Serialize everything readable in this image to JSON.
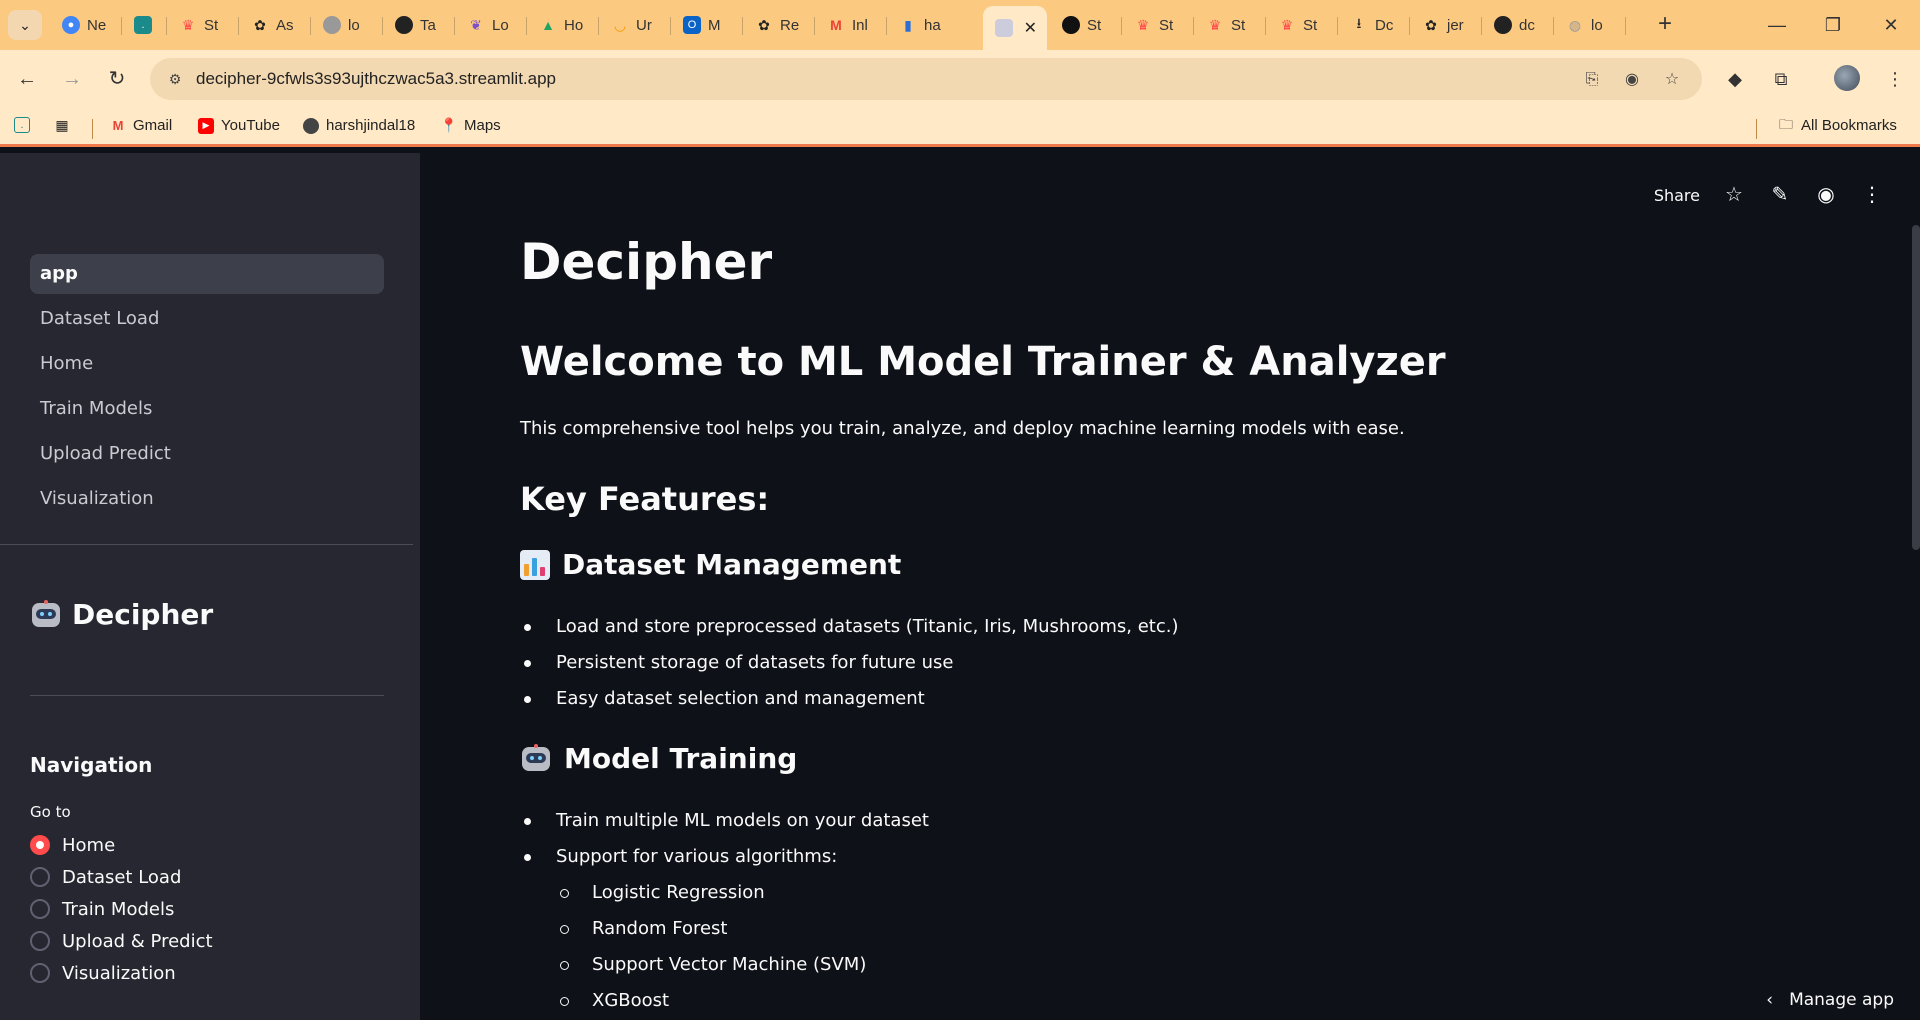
{
  "browser": {
    "tabs": [
      {
        "label": "Ne",
        "icon": "chrome-icon",
        "color": "#4285f4"
      },
      {
        "label": "",
        "icon": "app-icon",
        "color": "#1a8a8a"
      },
      {
        "label": "St",
        "icon": "streamlit-crown-icon",
        "color": "#ff4b4b"
      },
      {
        "label": "As",
        "icon": "openai-icon",
        "color": "#222222"
      },
      {
        "label": "lo",
        "icon": "avatar-icon",
        "color": "#777777"
      },
      {
        "label": "Ta",
        "icon": "github-icon",
        "color": "#222222"
      },
      {
        "label": "Lo",
        "icon": "feather-icon",
        "color": "#7b52c8"
      },
      {
        "label": "Ho",
        "icon": "drive-icon",
        "color": "#1fa463"
      },
      {
        "label": "Ur",
        "icon": "swirl-icon",
        "color": "#f59b00"
      },
      {
        "label": "M",
        "icon": "outlook-icon",
        "color": "#0a64c8"
      },
      {
        "label": "Re",
        "icon": "openai-icon",
        "color": "#222222"
      },
      {
        "label": "Inl",
        "icon": "gmail-icon",
        "color": "#ea4335"
      },
      {
        "label": "ha",
        "icon": "bar-chart-icon",
        "color": "#2b6fd6"
      },
      {
        "label": "",
        "icon": "robot-icon",
        "color": "#333333",
        "active": true
      },
      {
        "label": "St",
        "icon": "streamlit-dark-icon",
        "color": "#111111"
      },
      {
        "label": "St",
        "icon": "streamlit-crown-icon",
        "color": "#ff4b4b"
      },
      {
        "label": "St",
        "icon": "streamlit-crown-icon",
        "color": "#ff4b4b"
      },
      {
        "label": "St",
        "icon": "streamlit-crown-icon",
        "color": "#ff4b4b"
      },
      {
        "label": "Dc",
        "icon": "download-icon",
        "color": "#222222"
      },
      {
        "label": "jer",
        "icon": "openai-icon",
        "color": "#222222"
      },
      {
        "label": "dc",
        "icon": "github-icon",
        "color": "#222222"
      },
      {
        "label": "lo",
        "icon": "globe-icon",
        "color": "#999999"
      }
    ],
    "url": "decipher-9cfwls3s93ujthczwac5a3.streamlit.app",
    "bookmarks": [
      {
        "label": "Gmail",
        "icon": "gmail-icon"
      },
      {
        "label": "YouTube",
        "icon": "youtube-icon"
      },
      {
        "label": "harshjindal18",
        "icon": "github-icon"
      },
      {
        "label": "Maps",
        "icon": "maps-icon"
      }
    ],
    "all_bookmarks": "All Bookmarks"
  },
  "sidebar": {
    "pages": [
      "app",
      "Dataset Load",
      "Home",
      "Train Models",
      "Upload Predict",
      "Visualization"
    ],
    "active_page": "app",
    "title": "Decipher",
    "nav_heading": "Navigation",
    "goto_label": "Go to",
    "radio_options": [
      "Home",
      "Dataset Load",
      "Train Models",
      "Upload & Predict",
      "Visualization"
    ],
    "radio_selected": "Home"
  },
  "header": {
    "share": "Share"
  },
  "main": {
    "title": "Decipher",
    "welcome": "Welcome to ML Model Trainer & Analyzer",
    "intro": "This comprehensive tool helps you train, analyze, and deploy machine learning models with ease.",
    "key_features": "Key Features:",
    "dataset_section": {
      "heading": "Dataset Management",
      "items": [
        "Load and store preprocessed datasets (Titanic, Iris, Mushrooms, etc.)",
        "Persistent storage of datasets for future use",
        "Easy dataset selection and management"
      ]
    },
    "training_section": {
      "heading": "Model Training",
      "items": [
        "Train multiple ML models on your dataset",
        "Support for various algorithms:"
      ],
      "algorithms": [
        "Logistic Regression",
        "Random Forest",
        "Support Vector Machine (SVM)",
        "XGBoost"
      ]
    }
  },
  "manage_app": "Manage app",
  "colors": {
    "accent": "#ff4b4b",
    "sidebar_bg": "#262730",
    "main_bg": "#0e1117",
    "chrome_bg": "#ffe9c7"
  }
}
